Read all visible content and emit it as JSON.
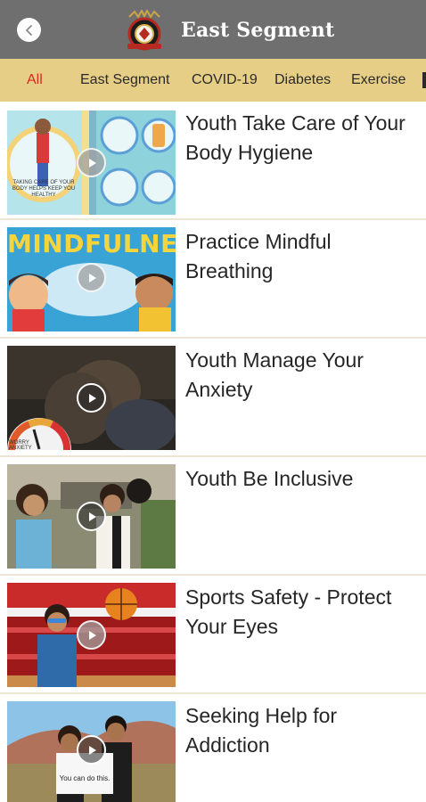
{
  "header": {
    "title": "East Segment",
    "back_icon": "chevron-left-icon",
    "logo_icon": "tribal-seal-logo"
  },
  "tabs": [
    {
      "label": "All",
      "active": true
    },
    {
      "label": "East Segment",
      "active": false
    },
    {
      "label": "COVID-19",
      "active": false
    },
    {
      "label": "Diabetes",
      "active": false
    },
    {
      "label": "Exercise",
      "active": false
    }
  ],
  "colors": {
    "header_bg": "#6f6f6f",
    "tab_bar_bg": "#e6ce87",
    "active_tab": "#d62b20",
    "divider": "#ede6d4"
  },
  "videos": [
    {
      "title": "Youth Take Care of Your Body Hygiene",
      "thumbnail_caption": "TAKING CARE OF YOUR BODY HELPS KEEP YOU HEALTHY",
      "play_icon": "play-icon"
    },
    {
      "title": "Practice Mindful Breathing",
      "thumbnail_caption": "MINDFULNESS",
      "play_icon": "play-icon"
    },
    {
      "title": "Youth Manage Your Anxiety",
      "thumbnail_caption": "WORRY ANXIETY",
      "play_icon": "play-icon"
    },
    {
      "title": "Youth Be Inclusive",
      "thumbnail_caption": "",
      "play_icon": "play-icon"
    },
    {
      "title": "Sports Safety - Protect Your Eyes",
      "thumbnail_caption": "",
      "play_icon": "play-icon"
    },
    {
      "title": "Seeking Help for Addiction",
      "thumbnail_caption": "You can do this.",
      "play_icon": "play-icon"
    }
  ]
}
